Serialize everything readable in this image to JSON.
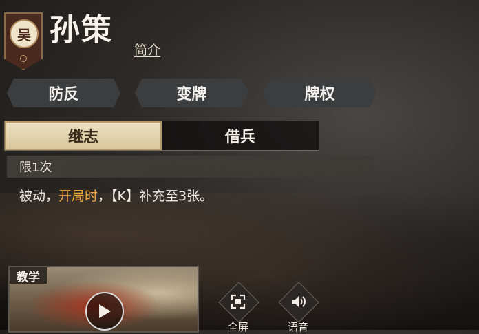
{
  "hero": {
    "faction": "吴",
    "name": "孙策",
    "intro_link": "简介"
  },
  "skill_tags": [
    "防反",
    "变牌",
    "牌权"
  ],
  "tabs": [
    {
      "label": "继志",
      "active": true
    },
    {
      "label": "借兵",
      "active": false
    }
  ],
  "skill": {
    "limit": "限1次",
    "desc": {
      "part1": "被动，",
      "highlight": "开局时",
      "part2": "，【K】补充至3张。"
    }
  },
  "video": {
    "label": "教学"
  },
  "controls": {
    "fullscreen": "全屏",
    "voice": "语音"
  },
  "colors": {
    "highlight": "#f0a33a",
    "active_tab": "#e3d3ad",
    "faction": "#4a2a1e"
  }
}
